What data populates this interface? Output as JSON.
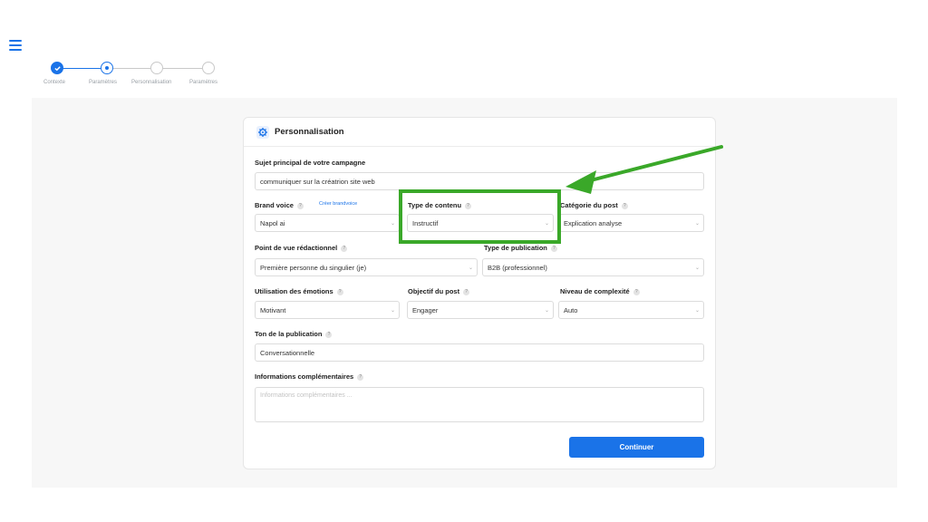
{
  "stepper": {
    "steps": [
      {
        "label": "Contexte",
        "state": "done"
      },
      {
        "label": "Paramètres",
        "state": "active"
      },
      {
        "label": "Personnalisation",
        "state": "todo"
      },
      {
        "label": "Paramètres",
        "state": "todo"
      }
    ]
  },
  "card": {
    "title": "Personnalisation",
    "icon": "gear-icon"
  },
  "form": {
    "subject": {
      "label": "Sujet principal de votre campagne",
      "value": "communiquer sur la créatrion site web"
    },
    "brand_voice": {
      "label": "Brand voice",
      "link": "Créer brandvoice",
      "value": "Napol ai"
    },
    "content_type": {
      "label": "Type de contenu",
      "value": "Instructif"
    },
    "post_category": {
      "label": "Catégorie du post",
      "value": "Explication analyse"
    },
    "point_of_view": {
      "label": "Point de vue rédactionnel",
      "value": "Première personne du singulier (je)"
    },
    "publication_type": {
      "label": "Type de publication",
      "value": "B2B (professionnel)"
    },
    "emotions": {
      "label": "Utilisation des émotions",
      "value": "Motivant"
    },
    "post_goal": {
      "label": "Objectif du post",
      "value": "Engager"
    },
    "complexity": {
      "label": "Niveau de complexité",
      "value": "Auto"
    },
    "tone": {
      "label": "Ton de la publication",
      "value": "Conversationnelle"
    },
    "extra_info": {
      "label": "Informations complémentaires",
      "placeholder": "Informations complémentaires ..."
    }
  },
  "buttons": {
    "continue": "Continuer"
  },
  "colors": {
    "accent": "#1a73e8",
    "annotation": "#3aa829"
  },
  "help_glyph": "?",
  "chevron_glyph": "⌄"
}
